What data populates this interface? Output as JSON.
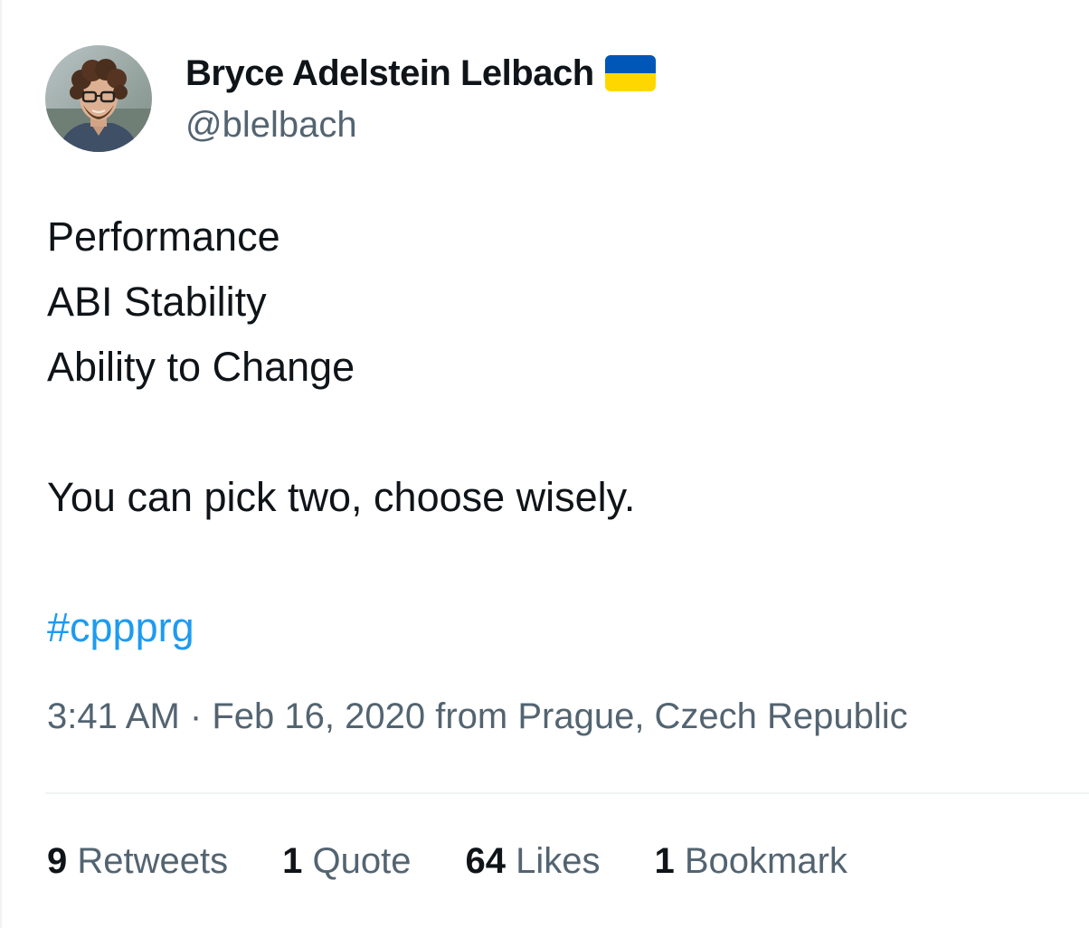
{
  "author": {
    "display_name": "Bryce Adelstein Lelbach",
    "handle": "@blelbach",
    "flag_icon": "ukraine-flag-icon"
  },
  "tweet": {
    "lines": [
      "Performance",
      "ABI Stability",
      "Ability to Change"
    ],
    "sentence": "You can pick two, choose wisely.",
    "hashtag": "#cppprg"
  },
  "meta": {
    "time": "3:41 AM",
    "separator": "·",
    "date": "Feb 16, 2020",
    "location_text": "from Prague, Czech Republic"
  },
  "stats": {
    "retweets": {
      "count": "9",
      "label": "Retweets"
    },
    "quotes": {
      "count": "1",
      "label": "Quote"
    },
    "likes": {
      "count": "64",
      "label": "Likes"
    },
    "bookmarks": {
      "count": "1",
      "label": "Bookmark"
    }
  },
  "colors": {
    "link": "#1d9bf0",
    "secondary_text": "#536471",
    "primary_text": "#0f1419",
    "flag_blue": "#0057b7",
    "flag_yellow": "#ffd700"
  }
}
